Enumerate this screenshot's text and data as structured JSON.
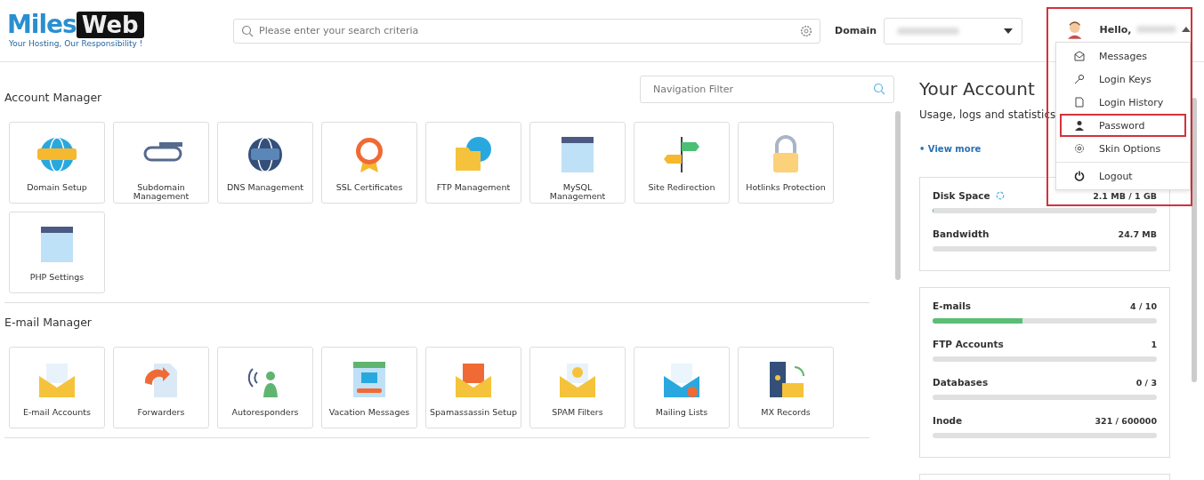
{
  "header": {
    "logo": {
      "word_1": "Miles",
      "word_2": "Web",
      "tagline": "Your Hosting, Our Responsibility !"
    },
    "search": {
      "placeholder": "Please enter your search criteria"
    },
    "domain_label": "Domain",
    "user_menu": {
      "greeting": "Hello,",
      "expanded": true,
      "highlighted": true,
      "items": [
        {
          "label": "Messages",
          "highlighted": false
        },
        {
          "label": "Login Keys",
          "highlighted": false
        },
        {
          "label": "Login History",
          "highlighted": false
        },
        {
          "label": "Password",
          "highlighted": true
        },
        {
          "label": "Skin Options",
          "highlighted": false
        },
        {
          "label": "Logout",
          "highlighted": false
        }
      ]
    }
  },
  "navigation_filter": {
    "placeholder": "Navigation Filter"
  },
  "sections": [
    {
      "title": "Account Manager",
      "tiles": [
        {
          "label": "Domain Setup"
        },
        {
          "label": "Subdomain Management"
        },
        {
          "label": "DNS Management"
        },
        {
          "label": "SSL Certificates"
        },
        {
          "label": "FTP Management"
        },
        {
          "label": "MySQL Management"
        },
        {
          "label": "Site Redirection"
        },
        {
          "label": "Hotlinks Protection"
        },
        {
          "label": "PHP Settings"
        }
      ]
    },
    {
      "title": "E-mail Manager",
      "tiles": [
        {
          "label": "E-mail Accounts"
        },
        {
          "label": "Forwarders"
        },
        {
          "label": "Autoresponders"
        },
        {
          "label": "Vacation Messages"
        },
        {
          "label": "Spamassassin Setup"
        },
        {
          "label": "SPAM Filters"
        },
        {
          "label": "Mailing Lists"
        },
        {
          "label": "MX Records"
        }
      ]
    }
  ],
  "account": {
    "title": "Your Account",
    "subtitle": "Usage, logs and statistics",
    "view_more": "• View more",
    "cards": [
      {
        "stats": [
          {
            "name": "Disk Space",
            "value": "2.1 MB / 1 GB",
            "level": 0.003,
            "refresh": true
          },
          {
            "name": "Bandwidth",
            "value": "24.7 MB",
            "level": 0,
            "refresh": false
          }
        ]
      },
      {
        "stats": [
          {
            "name": "E-mails",
            "value": "4 / 10",
            "level": 0.4,
            "refresh": false
          },
          {
            "name": "FTP Accounts",
            "value": "1",
            "level": 0,
            "refresh": false
          },
          {
            "name": "Databases",
            "value": "0 / 3",
            "level": 0,
            "refresh": false
          },
          {
            "name": "Inode",
            "value": "321 / 600000",
            "level": 0,
            "refresh": false
          }
        ]
      }
    ]
  }
}
